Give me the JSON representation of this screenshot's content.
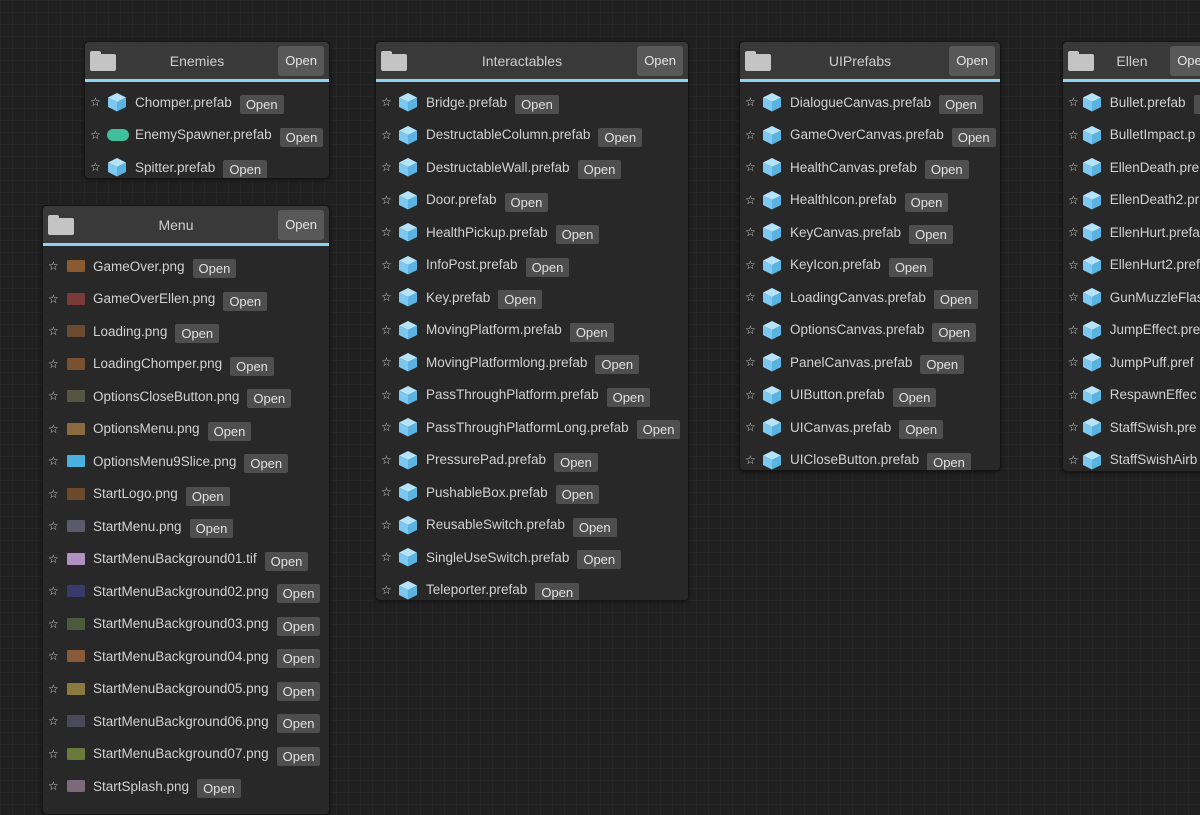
{
  "open_label": "Open",
  "colors": {
    "accent": "#8fd3f2",
    "prefab": "#7cc8f0",
    "spawner": "#3fbf9a"
  },
  "nodes": [
    {
      "id": "enemies",
      "title": "Enemies",
      "items": [
        {
          "name": "Chomper.prefab",
          "icon": "prefab-cube"
        },
        {
          "name": "EnemySpawner.prefab",
          "icon": "spawner-pill"
        },
        {
          "name": "Spitter.prefab",
          "icon": "prefab-cube"
        }
      ]
    },
    {
      "id": "menu",
      "title": "Menu",
      "items": [
        {
          "name": "GameOver.png",
          "icon": "image-thumb",
          "color": "#8a5a30"
        },
        {
          "name": "GameOverEllen.png",
          "icon": "image-thumb",
          "color": "#7a3a3a"
        },
        {
          "name": "Loading.png",
          "icon": "image-thumb",
          "color": "#6a4a30"
        },
        {
          "name": "LoadingChomper.png",
          "icon": "image-thumb",
          "color": "#7a5030"
        },
        {
          "name": "OptionsCloseButton.png",
          "icon": "image-thumb",
          "color": "#555544"
        },
        {
          "name": "OptionsMenu.png",
          "icon": "image-thumb",
          "color": "#8a6a40"
        },
        {
          "name": "OptionsMenu9Slice.png",
          "icon": "image-thumb",
          "color": "#4ab0e0"
        },
        {
          "name": "StartLogo.png",
          "icon": "image-thumb",
          "color": "#6a4a2a"
        },
        {
          "name": "StartMenu.png",
          "icon": "image-thumb",
          "color": "#5a5a6a"
        },
        {
          "name": "StartMenuBackground01.tif",
          "icon": "image-thumb",
          "color": "#b090c0"
        },
        {
          "name": "StartMenuBackground02.png",
          "icon": "image-thumb",
          "color": "#3a3a6a"
        },
        {
          "name": "StartMenuBackground03.png",
          "icon": "image-thumb",
          "color": "#4a5a3a"
        },
        {
          "name": "StartMenuBackground04.png",
          "icon": "image-thumb",
          "color": "#8a5a3a"
        },
        {
          "name": "StartMenuBackground05.png",
          "icon": "image-thumb",
          "color": "#8a7a40"
        },
        {
          "name": "StartMenuBackground06.png",
          "icon": "image-thumb",
          "color": "#4a4a5a"
        },
        {
          "name": "StartMenuBackground07.png",
          "icon": "image-thumb",
          "color": "#6a7a3a"
        },
        {
          "name": "StartSplash.png",
          "icon": "image-thumb",
          "color": "#7a6a7a"
        }
      ]
    },
    {
      "id": "interactables",
      "title": "Interactables",
      "items": [
        {
          "name": "Bridge.prefab",
          "icon": "prefab-cube"
        },
        {
          "name": "DestructableColumn.prefab",
          "icon": "prefab-cube"
        },
        {
          "name": "DestructableWall.prefab",
          "icon": "prefab-cube"
        },
        {
          "name": "Door.prefab",
          "icon": "prefab-cube"
        },
        {
          "name": "HealthPickup.prefab",
          "icon": "prefab-cube"
        },
        {
          "name": "InfoPost.prefab",
          "icon": "prefab-cube"
        },
        {
          "name": "Key.prefab",
          "icon": "prefab-cube"
        },
        {
          "name": "MovingPlatform.prefab",
          "icon": "prefab-cube"
        },
        {
          "name": "MovingPlatformlong.prefab",
          "icon": "prefab-cube"
        },
        {
          "name": "PassThroughPlatform.prefab",
          "icon": "prefab-cube"
        },
        {
          "name": "PassThroughPlatformLong.prefab",
          "icon": "prefab-cube"
        },
        {
          "name": "PressurePad.prefab",
          "icon": "prefab-cube"
        },
        {
          "name": "PushableBox.prefab",
          "icon": "prefab-cube"
        },
        {
          "name": "ReusableSwitch.prefab",
          "icon": "prefab-cube"
        },
        {
          "name": "SingleUseSwitch.prefab",
          "icon": "prefab-cube"
        },
        {
          "name": "Teleporter.prefab",
          "icon": "prefab-cube"
        }
      ]
    },
    {
      "id": "uiprefabs",
      "title": "UIPrefabs",
      "items": [
        {
          "name": "DialogueCanvas.prefab",
          "icon": "prefab-cube"
        },
        {
          "name": "GameOverCanvas.prefab",
          "icon": "prefab-cube"
        },
        {
          "name": "HealthCanvas.prefab",
          "icon": "prefab-cube"
        },
        {
          "name": "HealthIcon.prefab",
          "icon": "prefab-cube"
        },
        {
          "name": "KeyCanvas.prefab",
          "icon": "prefab-cube"
        },
        {
          "name": "KeyIcon.prefab",
          "icon": "prefab-cube"
        },
        {
          "name": "LoadingCanvas.prefab",
          "icon": "prefab-cube"
        },
        {
          "name": "OptionsCanvas.prefab",
          "icon": "prefab-cube"
        },
        {
          "name": "PanelCanvas.prefab",
          "icon": "prefab-cube"
        },
        {
          "name": "UIButton.prefab",
          "icon": "prefab-cube"
        },
        {
          "name": "UICanvas.prefab",
          "icon": "prefab-cube"
        },
        {
          "name": "UICloseButton.prefab",
          "icon": "prefab-cube"
        }
      ]
    },
    {
      "id": "ellen",
      "title": "Ellen",
      "items": [
        {
          "name": "Bullet.prefab",
          "icon": "prefab-cube"
        },
        {
          "name": "BulletImpact.p",
          "icon": "prefab-cube"
        },
        {
          "name": "EllenDeath.pre",
          "icon": "prefab-cube"
        },
        {
          "name": "EllenDeath2.pr",
          "icon": "prefab-cube"
        },
        {
          "name": "EllenHurt.prefa",
          "icon": "prefab-cube"
        },
        {
          "name": "EllenHurt2.pref",
          "icon": "prefab-cube"
        },
        {
          "name": "GunMuzzleFlas",
          "icon": "prefab-cube"
        },
        {
          "name": "JumpEffect.pre",
          "icon": "prefab-cube"
        },
        {
          "name": "JumpPuff.pref",
          "icon": "prefab-cube"
        },
        {
          "name": "RespawnEffec",
          "icon": "prefab-cube"
        },
        {
          "name": "StaffSwish.pre",
          "icon": "prefab-cube"
        },
        {
          "name": "StaffSwishAirb",
          "icon": "prefab-cube"
        }
      ]
    }
  ]
}
